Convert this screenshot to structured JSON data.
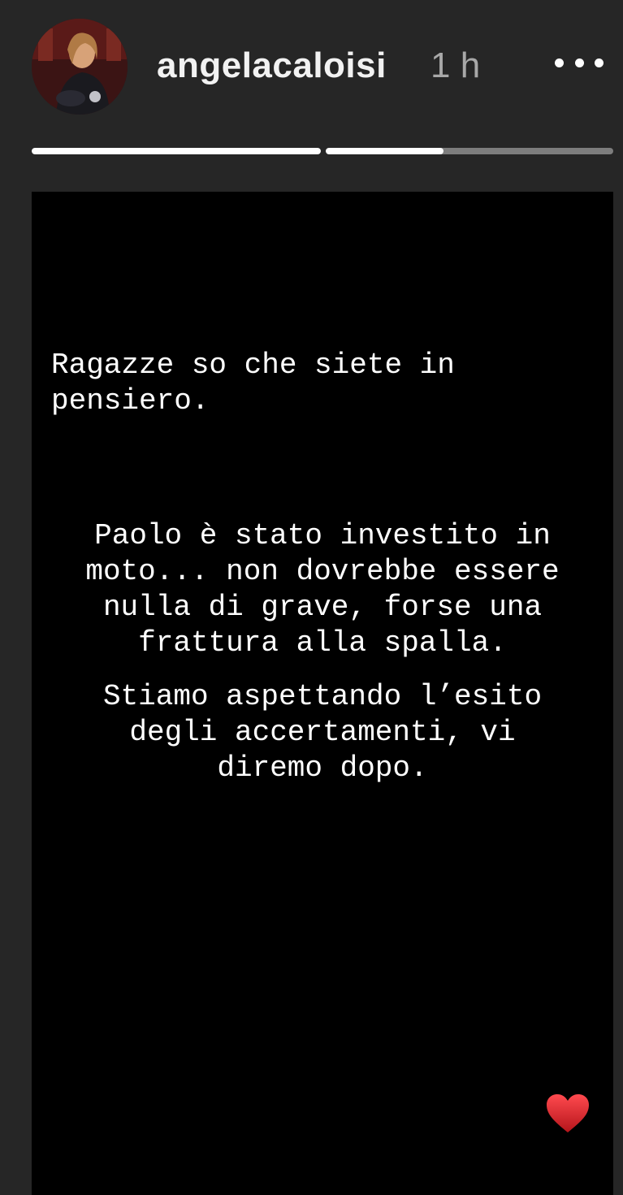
{
  "header": {
    "username": "angelacaloisi",
    "time": "1 h",
    "more_icon": "more-horizontal-icon"
  },
  "progress": {
    "segments": [
      {
        "fill_fraction": 1.0
      },
      {
        "fill_fraction": 0.41
      }
    ]
  },
  "story": {
    "paragraph_1": "Ragazze so che siete in\npensiero.",
    "paragraph_2": "Paolo è stato investito in\nmoto... non dovrebbe essere\nnulla di grave, forse una\nfrattura alla spalla.",
    "paragraph_3": "Stiamo aspettando l’esito\ndegli accertamenti, vi\ndiremo dopo.",
    "reaction_icon": "heart-icon",
    "reaction_color": "#e0242b"
  },
  "colors": {
    "background": "#262626",
    "story_background": "#000000",
    "progress_track": "#7d7d7d",
    "progress_fill": "#ffffff",
    "time_text": "#a8a8a8"
  }
}
